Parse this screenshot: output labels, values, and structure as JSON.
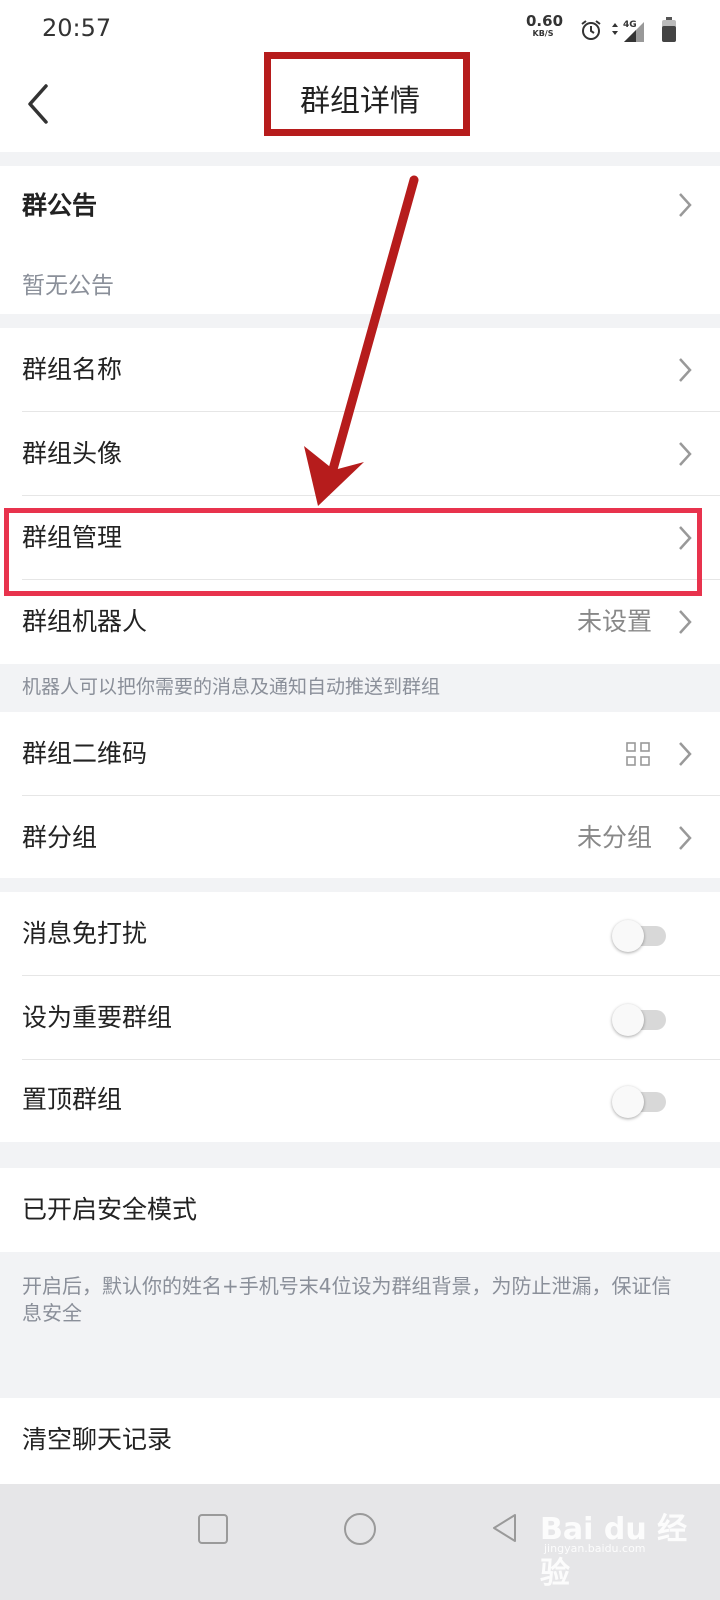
{
  "status_bar": {
    "time": "20:57",
    "net_speed": "0.60",
    "net_unit": "KB/S",
    "signal_label": "4G",
    "icons": [
      "alarm-icon",
      "signal-icon",
      "battery-icon"
    ]
  },
  "header": {
    "title": "群组详情",
    "back_icon": "back-chevron-icon"
  },
  "announcement": {
    "title": "群公告",
    "content": "暂无公告"
  },
  "group_info": {
    "name_label": "群组名称",
    "avatar_label": "群组头像",
    "manage_label": "群组管理",
    "robot_label": "群组机器人",
    "robot_value": "未设置",
    "robot_note": "机器人可以把你需要的消息及通知自动推送到群组"
  },
  "group_extra": {
    "qrcode_label": "群组二维码",
    "qrcode_icon": "qrcode-icon",
    "category_label": "群分组",
    "category_value": "未分组"
  },
  "toggles": [
    {
      "label": "消息免打扰",
      "on": false
    },
    {
      "label": "设为重要群组",
      "on": false
    },
    {
      "label": "置顶群组",
      "on": false
    }
  ],
  "safe_mode": {
    "label": "已开启安全模式",
    "note": "开启后，默认你的姓名+手机号末4位设为群组背景，为防止泄漏，保证信息安全"
  },
  "clear_history": {
    "label": "清空聊天记录"
  },
  "nav_bar": {
    "icons": [
      "recents-square-icon",
      "home-circle-icon",
      "back-triangle-icon"
    ]
  },
  "watermark": {
    "logo": "Bai du 经验",
    "sub": "jingyan.baidu.com"
  },
  "colors": {
    "highlight_title": "#b61c1c",
    "highlight_row": "#e8334d",
    "arrow": "#b61c1c",
    "page_bg": "#f2f3f5"
  }
}
